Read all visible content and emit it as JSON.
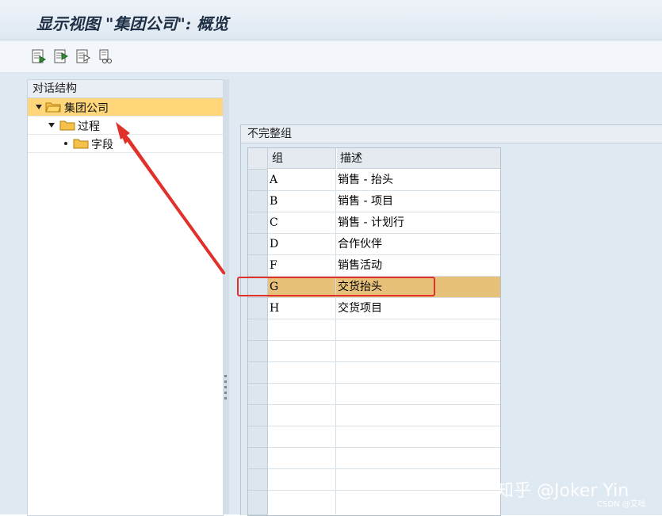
{
  "window": {
    "title": "显示视图 \"集团公司\": 概览"
  },
  "toolbar": {
    "buttons": [
      "edit-entry-icon",
      "next-entry-icon",
      "previous-entry-icon",
      "print-list-icon"
    ]
  },
  "tree_panel": {
    "header": "对话结构",
    "items": [
      {
        "label": "集团公司",
        "level": 0,
        "expanded": true,
        "selected": true
      },
      {
        "label": "过程",
        "level": 1,
        "expanded": true,
        "selected": false
      },
      {
        "label": "字段",
        "level": 2,
        "expanded": false,
        "selected": false
      }
    ]
  },
  "table_panel": {
    "title": "不完整组",
    "columns": [
      "组",
      "描述"
    ],
    "rows": [
      {
        "group": "A",
        "desc": "销售 - 抬头"
      },
      {
        "group": "B",
        "desc": "销售 - 项目"
      },
      {
        "group": "C",
        "desc": "销售 - 计划行"
      },
      {
        "group": "D",
        "desc": "合作伙伴"
      },
      {
        "group": "F",
        "desc": "销售活动"
      },
      {
        "group": "G",
        "desc": "交货抬头",
        "highlighted": true
      },
      {
        "group": "H",
        "desc": "交货项目"
      }
    ]
  },
  "annotation": {
    "color": "#e0322b"
  },
  "colors": {
    "selection": "#ffd77a",
    "row_highlight": "#e7c079",
    "background": "#dfe9f2"
  },
  "watermark": {
    "text": "知乎 @Joker Yin",
    "sub": "CSDN @艾吆"
  }
}
